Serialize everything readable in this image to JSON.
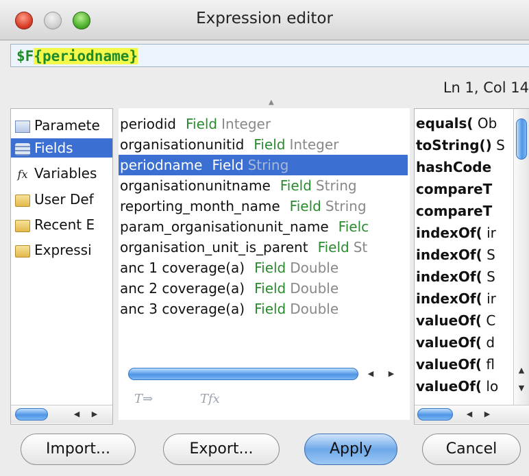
{
  "window": {
    "title": "Expression editor",
    "controls": [
      "close-button",
      "minimize-button",
      "zoom-button"
    ]
  },
  "expression": {
    "prefix": "$F",
    "highlight": "{periodname}"
  },
  "cursor_position": "Ln 1, Col 14",
  "categories": [
    {
      "label": "Paramete",
      "icon": "parameters-icon"
    },
    {
      "label": "Fields",
      "icon": "fields-icon"
    },
    {
      "label": "Variables",
      "icon": "fx-icon"
    },
    {
      "label": "User Def",
      "icon": "folder-icon"
    },
    {
      "label": "Recent E",
      "icon": "folder-icon"
    },
    {
      "label": "Expressi",
      "icon": "folder-icon"
    }
  ],
  "selected_category": "Fields",
  "fields": [
    {
      "name": "periodid",
      "kind": "Field",
      "type": "Integer"
    },
    {
      "name": "organisationunitid",
      "kind": "Field",
      "type": "Integer"
    },
    {
      "name": "periodname",
      "kind": "Field",
      "type": "String"
    },
    {
      "name": "organisationunitname",
      "kind": "Field",
      "type": "String"
    },
    {
      "name": "reporting_month_name",
      "kind": "Field",
      "type": "String"
    },
    {
      "name": "param_organisationunit_name",
      "kind": "Fielc",
      "type": ""
    },
    {
      "name": "organisation_unit_is_parent",
      "kind": "Field",
      "type": "St"
    },
    {
      "name": "anc 1 coverage(a)",
      "kind": "Field",
      "type": "Double"
    },
    {
      "name": "anc 2 coverage(a)",
      "kind": "Field",
      "type": "Double"
    },
    {
      "name": "anc 3 coverage(a)",
      "kind": "Field",
      "type": "Double"
    }
  ],
  "selected_field": "periodname",
  "methods": [
    {
      "name": "equals(",
      "rest": " Ob"
    },
    {
      "name": "toString()",
      "rest": " S"
    },
    {
      "name": "hashCode",
      "rest": ""
    },
    {
      "name": "compareT",
      "rest": ""
    },
    {
      "name": "compareT",
      "rest": ""
    },
    {
      "name": "indexOf(",
      "rest": " ir"
    },
    {
      "name": "indexOf(",
      "rest": " S"
    },
    {
      "name": "indexOf(",
      "rest": " S"
    },
    {
      "name": "indexOf(",
      "rest": " ir"
    },
    {
      "name": "valueOf(",
      "rest": " C"
    },
    {
      "name": "valueOf(",
      "rest": " d"
    },
    {
      "name": "valueOf(",
      "rest": " fl"
    },
    {
      "name": "valueOf(",
      "rest": " lo"
    }
  ],
  "buttons": {
    "import": "Import...",
    "export": "Export...",
    "apply": "Apply",
    "cancel": "Cancel"
  }
}
